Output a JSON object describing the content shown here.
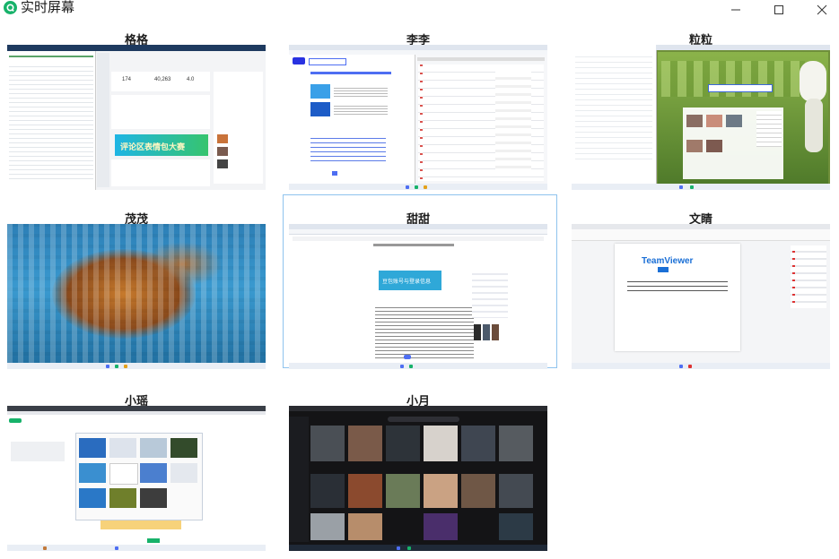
{
  "window": {
    "title": "实时屏幕",
    "logo_icon": "green-circle-logo-icon",
    "controls": [
      "minimize-icon",
      "maximize-icon",
      "close-icon"
    ]
  },
  "screens": [
    {
      "name": "格格",
      "banner_text": "评论区表情包大赛",
      "stats": [
        "174",
        "40,263",
        "4.0"
      ]
    },
    {
      "name": "李李"
    },
    {
      "name": "粒粒"
    },
    {
      "name": "茂茂"
    },
    {
      "name": "甜甜",
      "selected": true,
      "dialog_text": "豆包账号与登录信息"
    },
    {
      "name": "文睛",
      "doc_title": "TeamViewer"
    },
    {
      "name": "小瑶"
    },
    {
      "name": "小月"
    }
  ],
  "colors": {
    "accent": "#17b26a",
    "selection_border": "#8fc3ee",
    "dark_taskbar": "#1f2937"
  }
}
